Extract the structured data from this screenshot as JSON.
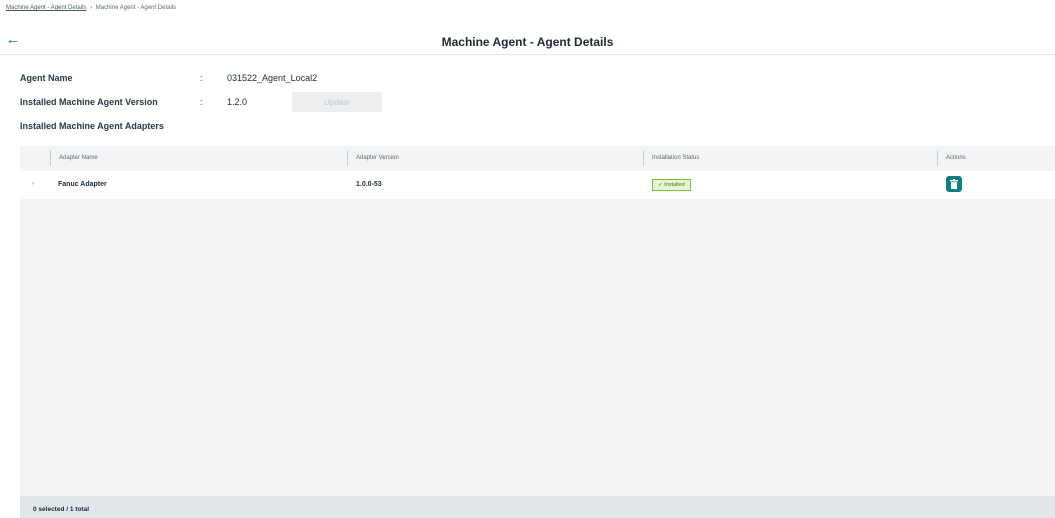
{
  "breadcrumb": {
    "link": "Machine Agent - Agent Details",
    "separator": "›",
    "current": "Machine Agent - Agent Details"
  },
  "header": {
    "back_icon": "arrow-left-icon",
    "title": "Machine Agent - Agent Details"
  },
  "details": {
    "agent_name_label": "Agent Name",
    "agent_name_value": "031522_Agent_Local2",
    "version_label": "Installed Machine Agent Version",
    "version_value": "1.2.0",
    "update_button": "Update",
    "adapters_label": "Installed Machine Agent Adapters",
    "colon": ":"
  },
  "table": {
    "columns": [
      "Adapter Name",
      "Adapter Version",
      "Installation Status",
      "Actions"
    ],
    "rows": [
      {
        "adapter_name": "Fanuc Adapter",
        "adapter_version": "1.0.0-53",
        "status": "✓ Installed",
        "action_icon": "trash-icon"
      }
    ],
    "colors": {
      "accent": "#0f7e85",
      "status_bg": "#e8f5d5",
      "status_border": "#7bbf3d"
    }
  },
  "footer": {
    "selection_text": "0 selected / 1 total"
  }
}
